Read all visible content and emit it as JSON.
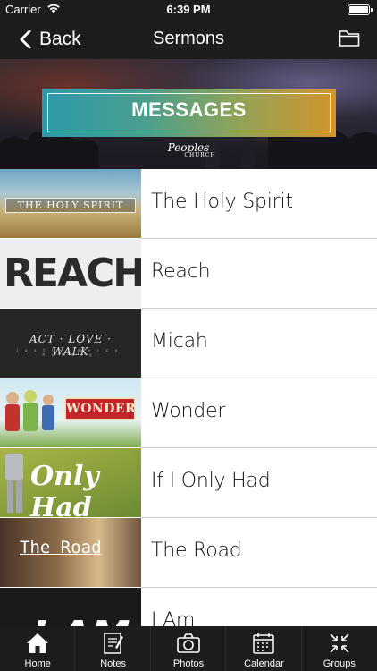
{
  "status_bar": {
    "carrier": "Carrier",
    "time": "6:39 PM"
  },
  "nav": {
    "back_label": "Back",
    "title": "Sermons"
  },
  "hero": {
    "banner": "MESSAGES",
    "logo": "Peoples",
    "logo_sub": "CHURCH"
  },
  "sermons": [
    {
      "title": "The Holy Spirit",
      "thumb_text": "THE HOLY SPIRIT"
    },
    {
      "title": "Reach",
      "thumb_text": "REACH"
    },
    {
      "title": "Micah",
      "thumb_text": "ACT · LOVE · WALK",
      "thumb_sub": "justly mercy humbly"
    },
    {
      "title": "Wonder",
      "thumb_text": "WONDER"
    },
    {
      "title": "If I Only Had",
      "thumb_text": "Only Had"
    },
    {
      "title": "The Road",
      "thumb_text": "The Road"
    },
    {
      "title": "I Am",
      "thumb_text": "I AM"
    }
  ],
  "tabs": [
    {
      "label": "Home",
      "icon": "home-icon"
    },
    {
      "label": "Notes",
      "icon": "notes-icon"
    },
    {
      "label": "Photos",
      "icon": "camera-icon"
    },
    {
      "label": "Calendar",
      "icon": "calendar-icon"
    },
    {
      "label": "Groups",
      "icon": "groups-icon"
    }
  ]
}
